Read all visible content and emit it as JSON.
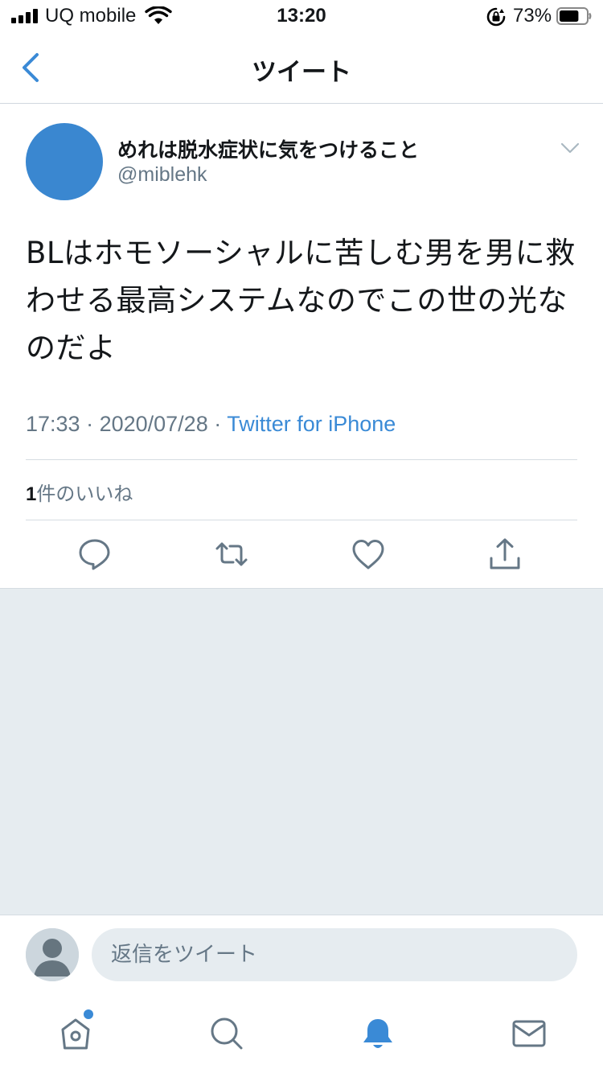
{
  "status_bar": {
    "carrier": "UQ mobile",
    "time": "13:20",
    "battery_percent": "73%",
    "battery_level": 0.73
  },
  "nav": {
    "title": "ツイート"
  },
  "tweet": {
    "display_name": "めれは脱水症状に気をつけること",
    "handle": "@miblehk",
    "text": "BLはホモソーシャルに苦しむ男を男に救わせる最高システムなのでこの世の光なのだよ",
    "time": "17:33",
    "separator": " · ",
    "date": "2020/07/28",
    "source": "Twitter for iPhone",
    "like_count": "1",
    "like_label": "件のいいね"
  },
  "reply": {
    "placeholder": "返信をツイート"
  },
  "colors": {
    "accent": "#3a8ad6",
    "avatar": "#3a87d0",
    "secondary_text": "#657786",
    "background_gray": "#e6ecf0"
  },
  "icons": {
    "back": "chevron-left-icon",
    "caret": "chevron-down-icon",
    "reply": "reply-icon",
    "retweet": "retweet-icon",
    "like": "heart-icon",
    "share": "share-icon",
    "home": "home-icon",
    "search": "search-icon",
    "notifications": "bell-icon",
    "messages": "mail-icon"
  }
}
